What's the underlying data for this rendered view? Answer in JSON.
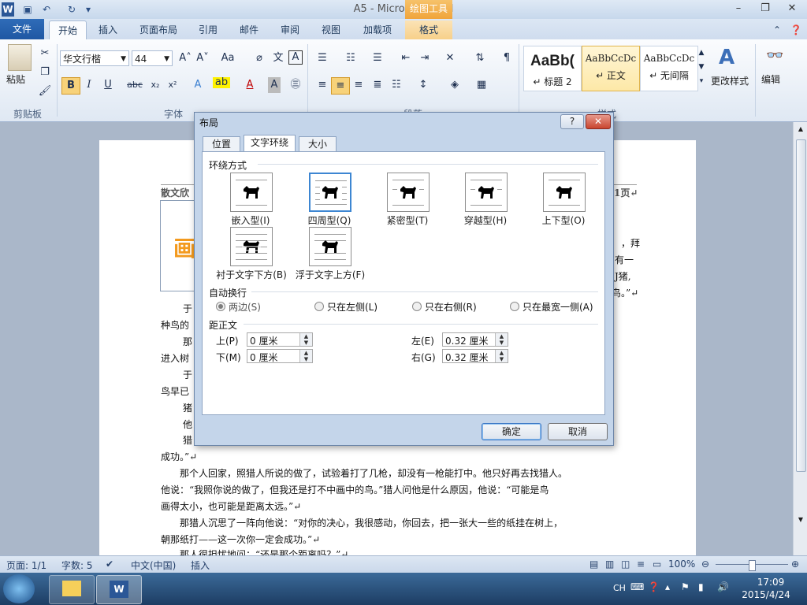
{
  "app": {
    "title": "A5 - Microsoft Word",
    "tools_title": "绘图工具",
    "window_buttons": [
      "–",
      "❐",
      "✕"
    ]
  },
  "tabs": [
    {
      "label": "文件"
    },
    {
      "label": "开始"
    },
    {
      "label": "插入"
    },
    {
      "label": "页面布局"
    },
    {
      "label": "引用"
    },
    {
      "label": "邮件"
    },
    {
      "label": "审阅"
    },
    {
      "label": "视图"
    },
    {
      "label": "加载项"
    },
    {
      "label": "格式"
    }
  ],
  "ribbon": {
    "clipboard": {
      "paste": "粘贴",
      "group": "剪贴板"
    },
    "font": {
      "name": "华文行楷",
      "size": "44",
      "group": "字体"
    },
    "paragraph": {
      "group": "段落"
    },
    "styles": {
      "items": [
        {
          "sample": "AaBb(",
          "name": "↵ 标题 2"
        },
        {
          "sample": "AaBbCcDc",
          "name": "↵ 正文"
        },
        {
          "sample": "AaBbCcDc",
          "name": "↵ 无间隔"
        }
      ],
      "change": "更改样式",
      "group": "样式"
    },
    "editing": {
      "label": "编辑"
    }
  },
  "document": {
    "header_left": "散文欣",
    "header_right": "1页↵",
    "side_text": [
      "，拜",
      "有一",
      "J猪,",
      "鸟。”↵"
    ],
    "lines": [
      "于                                                          他各",
      "种鸟的",
      "那                                                          他一",
      "进入树",
      "于                                                          枪，",
      "鸟早已",
      "猪",
      "他",
      "猎                                                          定会",
      "成功。”↵",
      "　　那个人回家，照猎人所说的做了，试验着打了几枪，却没有一枪能打中。他只好再去找猎人。",
      "他说：“我照你说的做了，但我还是打不中画中的鸟。”猎人问他是什么原因，他说：“可能是鸟",
      "画得太小，也可能是距离太远。”↵",
      "　　那猎人沉思了一阵向他说：“对你的决心，我很感动，你回去，把一张大一些的纸挂在树上，",
      "朝那纸打——这一次你一定会成功。”↵",
      "　　那人很担忧地问：“还是那个距离吗？”↵"
    ]
  },
  "status": {
    "page": "页面: 1/1",
    "words": "字数: 5",
    "lang": "中文(中国)",
    "mode": "插入",
    "zoom": "100%"
  },
  "taskbar": {
    "ime": "CH",
    "time": "17:09",
    "date": "2015/4/24"
  },
  "dialog": {
    "title": "布局",
    "help": "?",
    "close": "✕",
    "tabs": [
      "位置",
      "文字环绕",
      "大小"
    ],
    "wrap_section": "环绕方式",
    "wrap_options": [
      {
        "label": "嵌入型(I)"
      },
      {
        "label": "四周型(Q)"
      },
      {
        "label": "紧密型(T)"
      },
      {
        "label": "穿越型(H)"
      },
      {
        "label": "上下型(O)"
      },
      {
        "label": "衬于文字下方(B)"
      },
      {
        "label": "浮于文字上方(F)"
      }
    ],
    "auto_wrap_section": "自动换行",
    "auto_wrap_options": [
      "两边(S)",
      "只在左侧(L)",
      "只在右侧(R)",
      "只在最宽一侧(A)"
    ],
    "distance_section": "距正文",
    "distance": {
      "top_label": "上(P)",
      "top_value": "0 厘米",
      "bottom_label": "下(M)",
      "bottom_value": "0 厘米",
      "left_label": "左(E)",
      "left_value": "0.32 厘米",
      "right_label": "右(G)",
      "right_value": "0.32 厘米"
    },
    "ok": "确定",
    "cancel": "取消"
  }
}
